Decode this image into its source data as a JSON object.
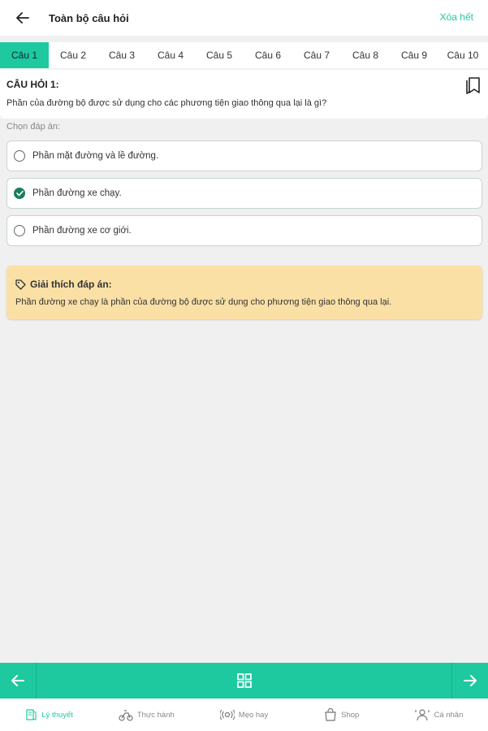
{
  "header": {
    "title": "Toàn bộ câu hỏi",
    "clear_label": "Xóa hết"
  },
  "tabs": [
    {
      "label": "Câu 1",
      "active": true
    },
    {
      "label": "Câu 2"
    },
    {
      "label": "Câu 3"
    },
    {
      "label": "Câu 4"
    },
    {
      "label": "Câu 5"
    },
    {
      "label": "Câu 6"
    },
    {
      "label": "Câu 7"
    },
    {
      "label": "Câu 8"
    },
    {
      "label": "Câu 9"
    },
    {
      "label": "Câu 10"
    }
  ],
  "question": {
    "label": "CÂU HỎI 1:",
    "text": "Phần của đường bộ được sử dụng cho các phương tiện giao thông qua lại là gì?"
  },
  "choose_label": "Chọn đáp án:",
  "answers": [
    {
      "text": "Phần mặt đường và lề đường.",
      "selected": false
    },
    {
      "text": "Phần đường xe chạy.",
      "selected": true
    },
    {
      "text": "Phần đường xe cơ giới.",
      "selected": false
    }
  ],
  "explanation": {
    "title": "Giải thích đáp án:",
    "text": "Phần đường xe chạy là phần của đường bộ được sử dụng cho phương tiện giao thông qua lại."
  },
  "bottom_tabs": [
    {
      "label": "Lý thuyết",
      "icon": "book-icon",
      "active": true
    },
    {
      "label": "Thực hành",
      "icon": "motorbike-icon"
    },
    {
      "label": "Mẹo hay",
      "icon": "tips-icon"
    },
    {
      "label": "Shop",
      "icon": "shop-icon"
    },
    {
      "label": "Cá nhân",
      "icon": "profile-icon"
    }
  ],
  "colors": {
    "accent": "#1ec9a0",
    "selected": "#1a7d5e",
    "explanation_bg": "#fbe0a6",
    "background": "#f0f0f0"
  }
}
